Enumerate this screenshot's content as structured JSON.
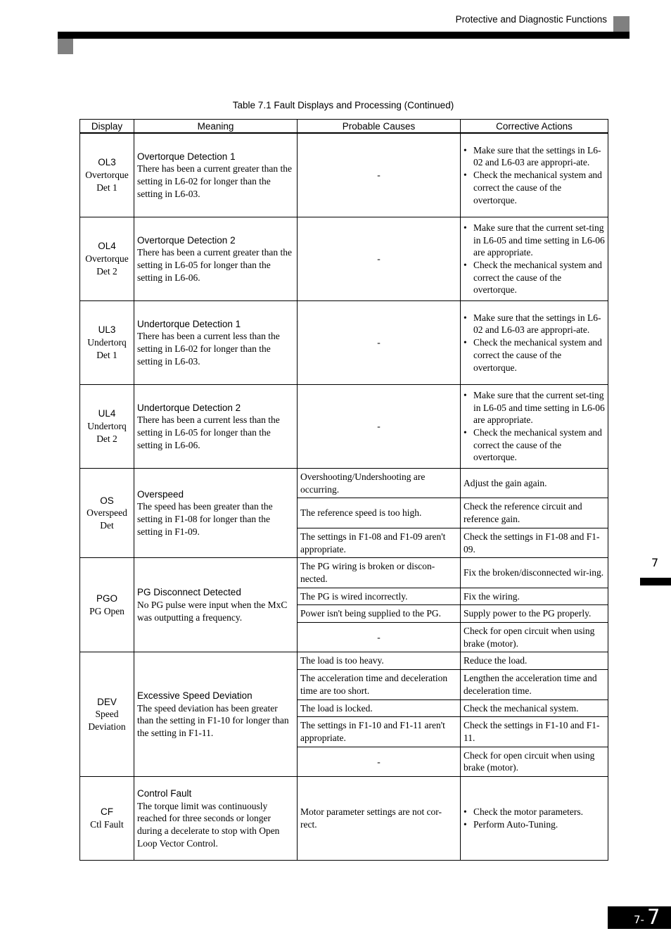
{
  "header": {
    "section_title": "Protective and Diagnostic Functions"
  },
  "table": {
    "caption": "Table 7.1  Fault Displays and Processing (Continued)",
    "columns": [
      "Display",
      "Meaning",
      "Probable Causes",
      "Corrective Actions"
    ],
    "rows": [
      {
        "code": "OL3",
        "display_sub": [
          "Overtorque",
          "Det 1"
        ],
        "meaning_title": "Overtorque Detection 1",
        "meaning_text": "There has been a current greater than the setting in L6-02 for longer than the setting in L6-03.",
        "causes": [
          {
            "cause": "-",
            "actions": [
              "Make sure that the settings in L6-02 and L6-03 are appropri-ate.",
              "Check the mechanical system and correct the cause of the overtorque."
            ]
          }
        ]
      },
      {
        "code": "OL4",
        "display_sub": [
          "Overtorque",
          "Det 2"
        ],
        "meaning_title": "Overtorque Detection 2",
        "meaning_text": "There has been a current greater than the setting in L6-05 for longer than the setting in L6-06.",
        "causes": [
          {
            "cause": "-",
            "actions": [
              "Make sure that the current set-ting in L6-05 and time setting in L6-06 are appropriate.",
              "Check the mechanical system and correct the cause of the overtorque."
            ]
          }
        ]
      },
      {
        "code": "UL3",
        "display_sub": [
          "Undertorq",
          "Det 1"
        ],
        "meaning_title": "Undertorque Detection 1",
        "meaning_text": "There has been a current less than the setting in L6-02 for longer than the setting in L6-03.",
        "causes": [
          {
            "cause": "-",
            "actions": [
              "Make sure that the settings in L6-02 and L6-03 are appropri-ate.",
              "Check the mechanical system and correct the cause of the overtorque."
            ]
          }
        ]
      },
      {
        "code": "UL4",
        "display_sub": [
          "Undertorq",
          "Det 2"
        ],
        "meaning_title": "Undertorque Detection 2",
        "meaning_text": "There has been a current less than the setting in L6-05 for longer than the setting in L6-06.",
        "causes": [
          {
            "cause": "-",
            "actions": [
              "Make sure that the current set-ting in L6-05 and time setting in L6-06 are appropriate.",
              "Check the mechanical system and correct the cause of the overtorque."
            ]
          }
        ]
      },
      {
        "code": "OS",
        "display_sub": [
          "Overspeed",
          "Det"
        ],
        "meaning_title": "Overspeed",
        "meaning_text": "The speed has been greater than the setting in F1-08 for longer than the setting in F1-09.",
        "causes": [
          {
            "cause": "Overshooting/Undershooting are occurring.",
            "action": "Adjust the gain again."
          },
          {
            "cause": "The reference speed is too high.",
            "action": "Check the reference circuit and reference gain."
          },
          {
            "cause": "The settings in F1-08 and F1-09 aren't appropriate.",
            "action": "Check the settings in F1-08 and F1-09."
          }
        ]
      },
      {
        "code": "PGO",
        "display_sub": [
          "PG Open"
        ],
        "meaning_title": "PG Disconnect Detected",
        "meaning_text": "No PG pulse were input when the MxC was outputting a frequency.",
        "causes": [
          {
            "cause": "The PG wiring is broken or discon-nected.",
            "action": "Fix the broken/disconnected wir-ing."
          },
          {
            "cause": "The PG is wired incorrectly.",
            "action": "Fix the wiring."
          },
          {
            "cause": "Power isn't being supplied to the PG.",
            "action": "Supply power to the PG properly."
          },
          {
            "cause": "-",
            "action": "Check for open circuit when using brake (motor)."
          }
        ]
      },
      {
        "code": "DEV",
        "display_sub": [
          "Speed",
          "Deviation"
        ],
        "meaning_title": "Excessive Speed Deviation",
        "meaning_text": "The speed deviation has been greater than the setting in F1-10 for longer than the setting in F1-11.",
        "causes": [
          {
            "cause": "The load is too heavy.",
            "action": "Reduce the load."
          },
          {
            "cause": "The acceleration time and deceleration time are too short.",
            "action": "Lengthen the acceleration time and deceleration time."
          },
          {
            "cause": "The load is locked.",
            "action": "Check the mechanical system."
          },
          {
            "cause": "The settings in F1-10 and F1-11 aren't appropriate.",
            "action": "Check the settings in F1-10 and F1-11."
          },
          {
            "cause": "-",
            "action": "Check for open circuit when using brake (motor)."
          }
        ]
      },
      {
        "code": "CF",
        "display_sub": [
          "Ctl Fault"
        ],
        "meaning_title": "Control Fault",
        "meaning_text": "The torque limit was continuously reached for three seconds or longer during a decelerate to stop with Open Loop Vector Control.",
        "causes": [
          {
            "cause": "Motor parameter settings are not cor-rect.",
            "actions": [
              "Check the motor parameters.",
              "Perform Auto-Tuning."
            ]
          }
        ]
      }
    ]
  },
  "side_tab": {
    "chapter": "7"
  },
  "footer": {
    "chapter": "7",
    "separator": "-",
    "page": "7"
  }
}
